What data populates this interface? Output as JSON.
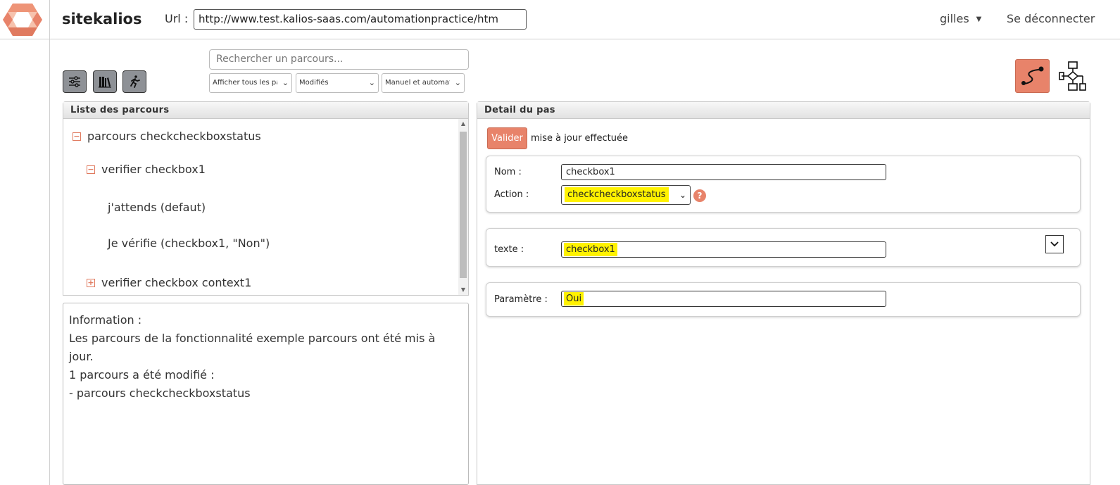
{
  "header": {
    "app_title": "sitekalios",
    "url_label": "Url :",
    "url_value": "http://www.test.kalios-saas.com/automationpractice/htm",
    "user_name": "gilles",
    "logout_label": "Se déconnecter"
  },
  "toolbar": {
    "search_placeholder": "Rechercher un parcours...",
    "filter_display": "Afficher tous les par",
    "filter_state": "Modifiés",
    "filter_mode": "Manuel et automatis"
  },
  "route_list": {
    "title": "Liste des parcours",
    "items": [
      {
        "label": "parcours checkcheckboxstatus",
        "toggle": "−"
      },
      {
        "label": "verifier checkbox1",
        "toggle": "−"
      },
      {
        "label": "j'attends (defaut)"
      },
      {
        "label": "Je vérifie (checkbox1, \"Non\")"
      },
      {
        "label": "verifier checkbox context1",
        "toggle": "+"
      }
    ]
  },
  "info": {
    "lines": [
      "Information :",
      "Les parcours de la fonctionnalité exemple parcours ont été mis à jour.",
      "1 parcours a été modifié :",
      "- parcours checkcheckboxstatus"
    ]
  },
  "step_detail": {
    "title": "Detail du pas",
    "validate_label": "Valider",
    "status_message": "mise à jour effectuée",
    "name_label": "Nom :",
    "name_value": "checkbox1",
    "action_label": "Action :",
    "action_value": "checkcheckboxstatus",
    "help_symbol": "?",
    "text_label": "texte :",
    "text_value": "checkbox1",
    "param_label": "Paramètre :",
    "param_value": "Oui"
  },
  "colors": {
    "accent": "#e8836a",
    "highlight": "#fff200",
    "tool_button": "#8e9196"
  }
}
